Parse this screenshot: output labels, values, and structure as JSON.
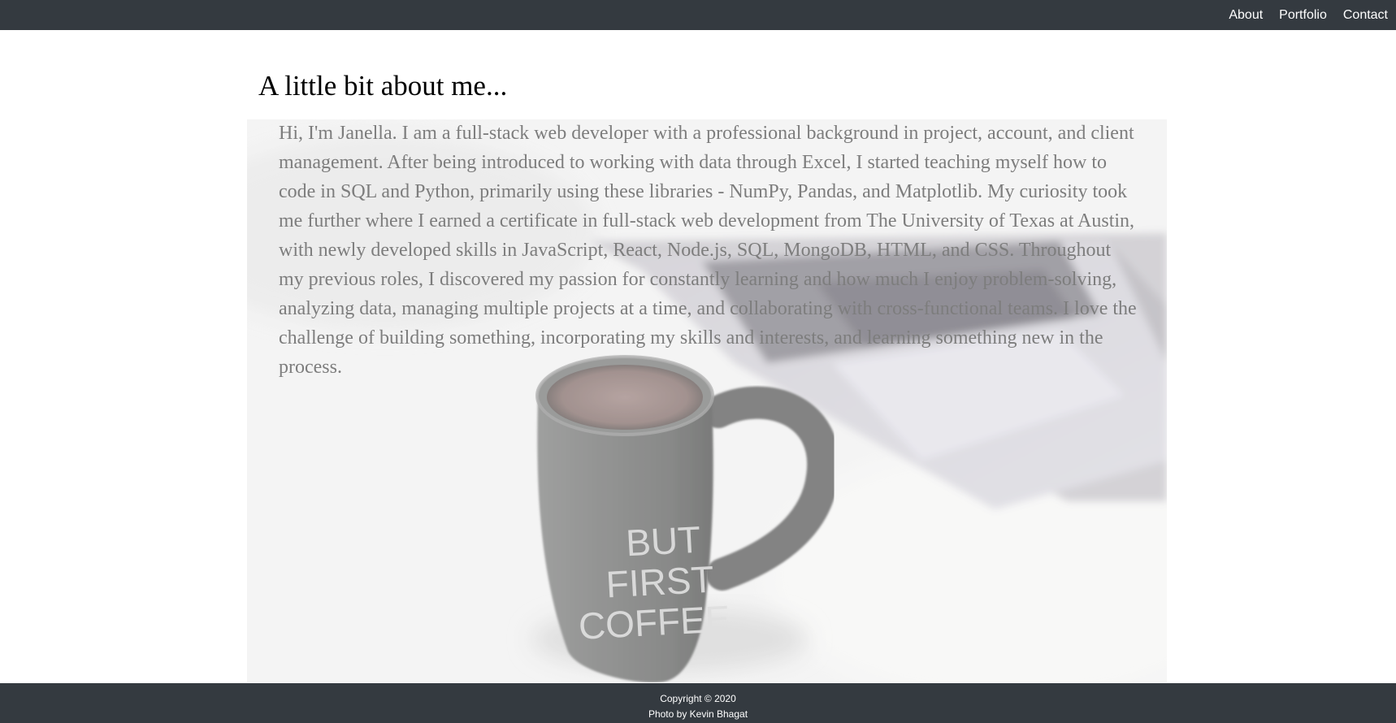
{
  "nav": {
    "links": [
      {
        "label": "About"
      },
      {
        "label": "Portfolio"
      },
      {
        "label": "Contact"
      }
    ]
  },
  "main": {
    "heading": "A little bit about me...",
    "body": "Hi, I'm Janella. I am a full-stack web developer with a professional background in project, account, and client management. After being introduced to working with data through Excel, I started teaching myself how to code in SQL and Python, primarily using these libraries - NumPy, Pandas, and Matplotlib. My curiosity took me further where I earned a certificate in full-stack web development from The University of Texas at Austin, with newly developed skills in JavaScript, React, Node.js, SQL, MongoDB, HTML, and CSS. Throughout my previous roles, I discovered my passion for constantly learning and how much I enjoy problem-solving, analyzing data, managing multiple projects at a time, and collaborating with cross-functional teams. I love the challenge of building something, incorporating my skills and interests, and learning something new in the process.",
    "mug_text": [
      "BUT",
      "FIRST",
      "COFFEE"
    ]
  },
  "footer": {
    "copyright": "Copyright © 2020",
    "photo_credit": "Photo by Kevin Bhagat"
  },
  "colors": {
    "navbar": "#343a40",
    "footer": "#343a40",
    "body_text": "#7d7d7d",
    "heading": "#000000"
  }
}
